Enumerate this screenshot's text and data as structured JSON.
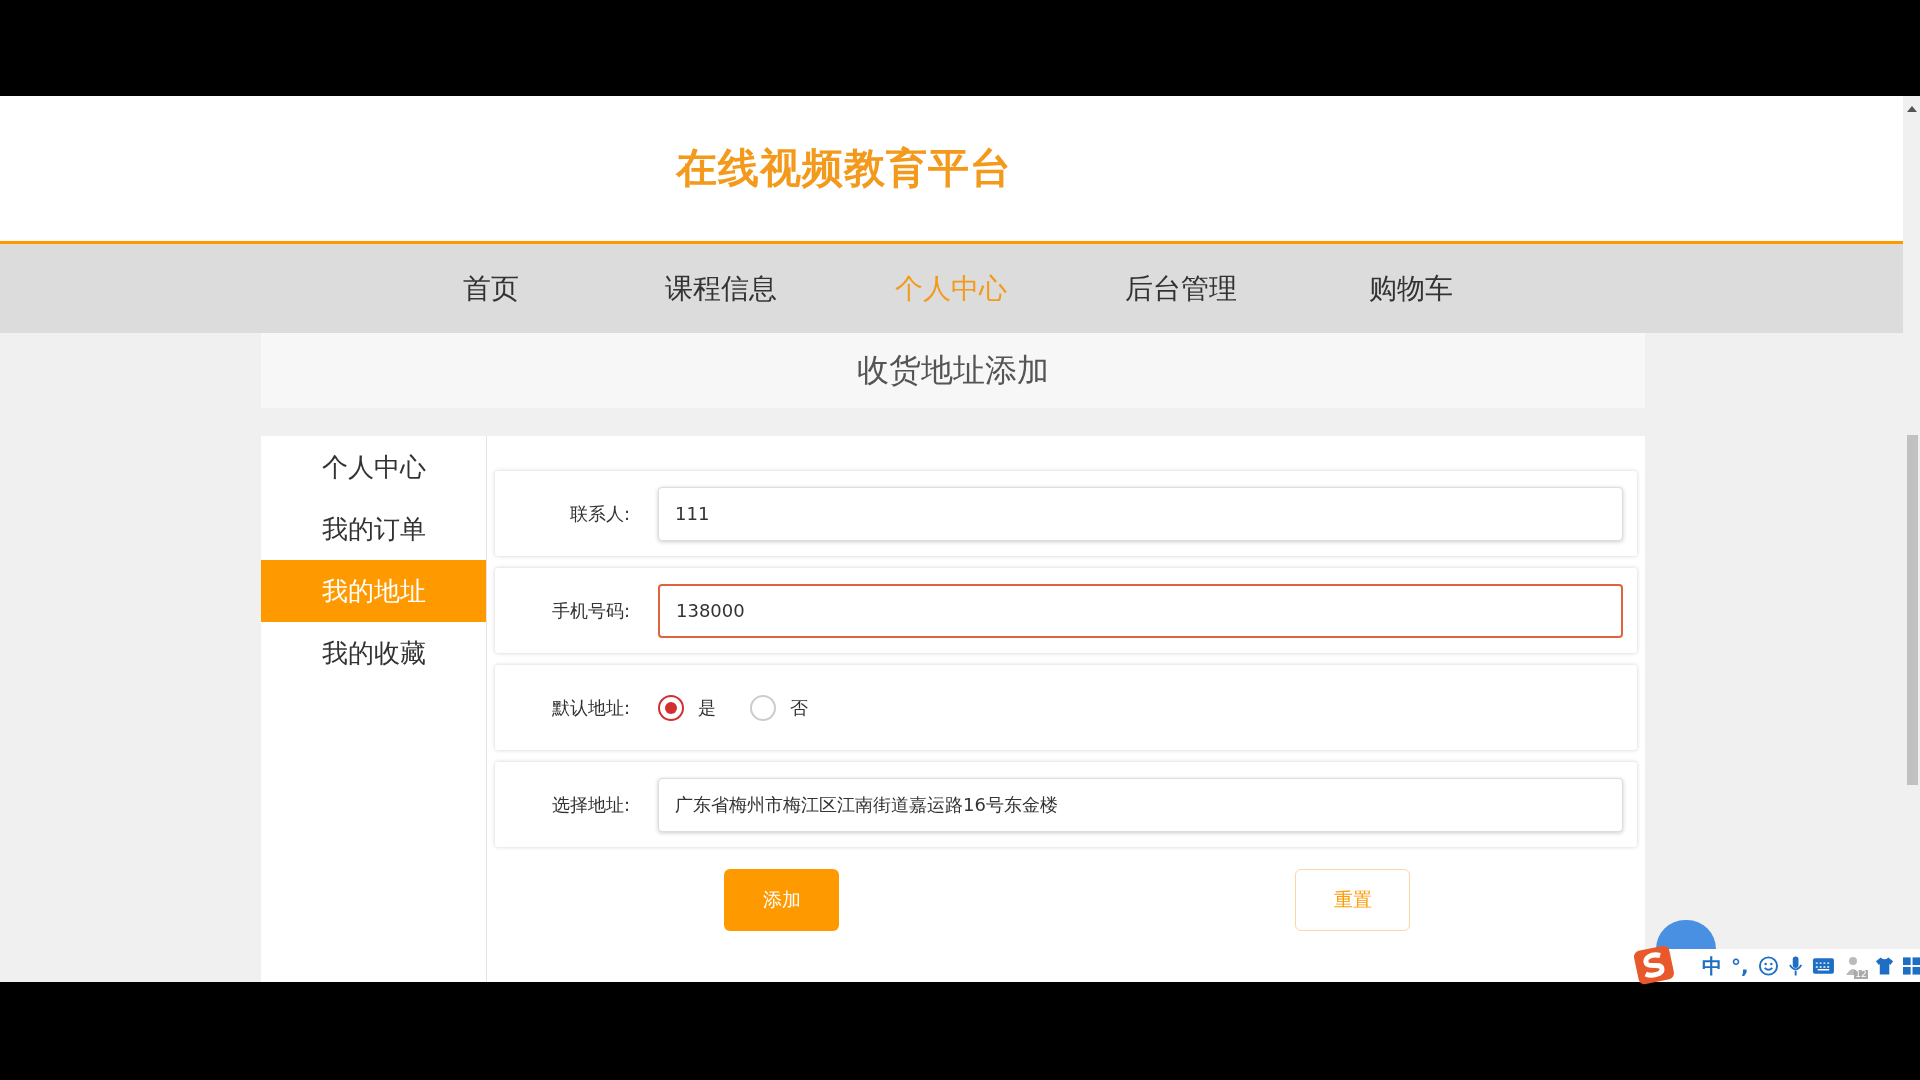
{
  "header": {
    "title": "在线视频教育平台"
  },
  "nav": [
    {
      "label": "首页",
      "selected": false
    },
    {
      "label": "课程信息",
      "selected": false
    },
    {
      "label": "个人中心",
      "selected": true
    },
    {
      "label": "后台管理",
      "selected": false
    },
    {
      "label": "购物车",
      "selected": false
    }
  ],
  "page_title": "收货地址添加",
  "sidebar": {
    "items": [
      {
        "label": "个人中心",
        "selected": false
      },
      {
        "label": "我的订单",
        "selected": false
      },
      {
        "label": "我的地址",
        "selected": true
      },
      {
        "label": "我的收藏",
        "selected": false
      }
    ]
  },
  "form": {
    "fields": [
      {
        "kind": "input",
        "label": "联系人:",
        "value": "111",
        "focused": false
      },
      {
        "kind": "input",
        "label": "手机号码:",
        "value": "138000",
        "focused": true
      },
      {
        "kind": "radio",
        "label": "默认地址:",
        "options": [
          {
            "label": "是",
            "selected": true
          },
          {
            "label": "否",
            "selected": false
          }
        ]
      },
      {
        "kind": "input",
        "label": "选择地址:",
        "value": "广东省梅州市梅江区江南街道嘉运路16号东金楼",
        "focused": false
      }
    ],
    "buttons": [
      {
        "kind": "primary",
        "label": "添加"
      },
      {
        "kind": "outline",
        "label": "重置"
      }
    ]
  },
  "ime_toolbar": {
    "mode": "中",
    "punctuation": "°,",
    "badge": "12"
  }
}
